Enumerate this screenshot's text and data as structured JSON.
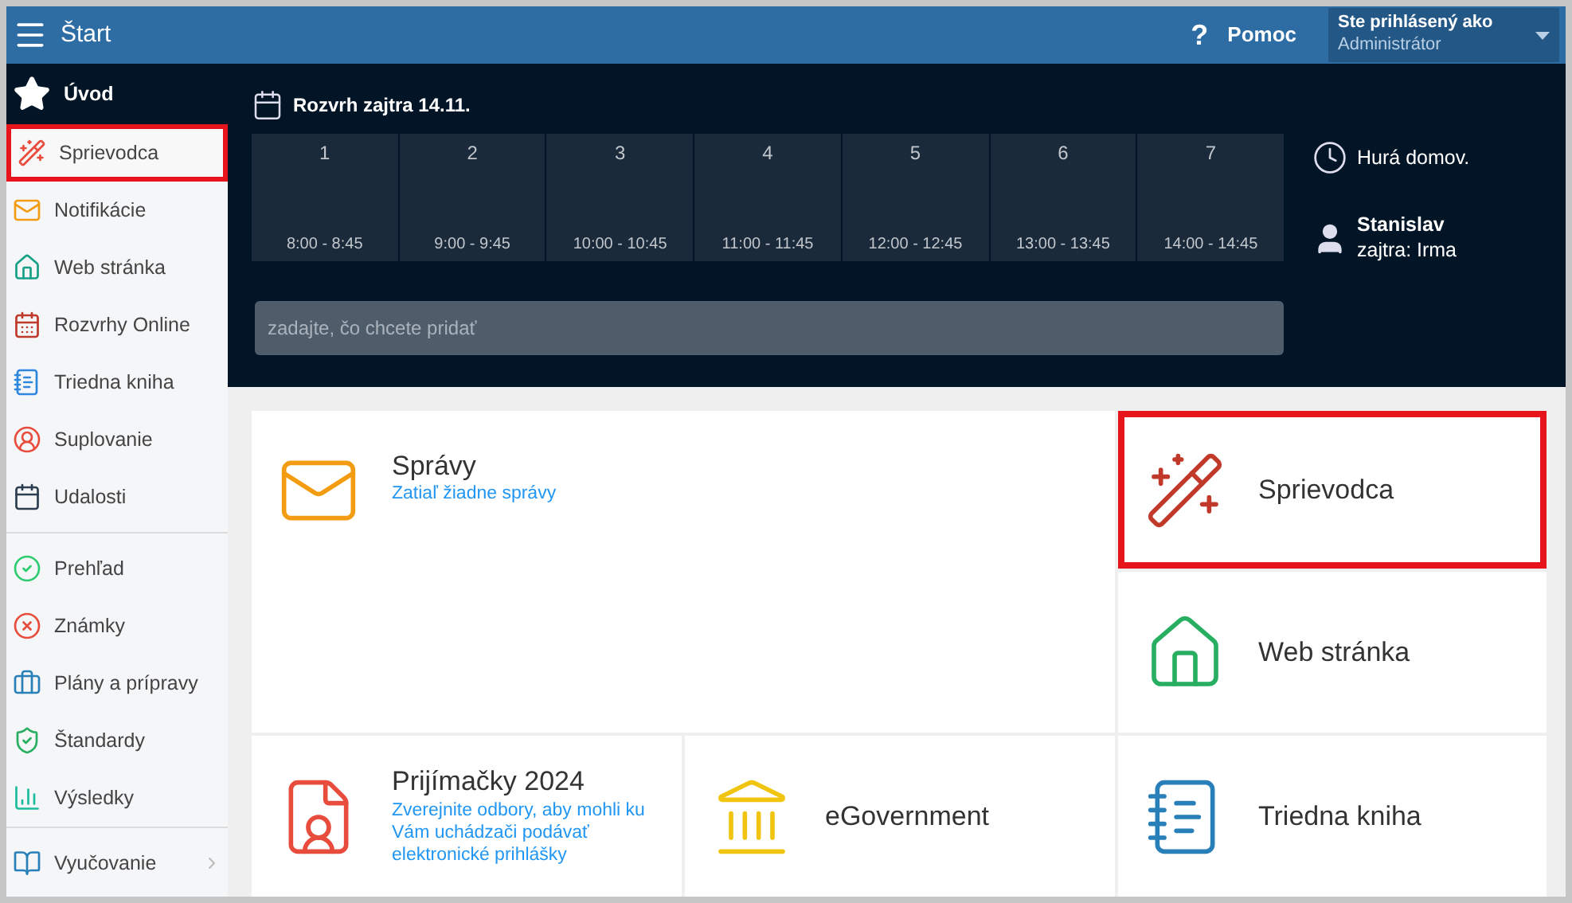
{
  "topbar": {
    "title": "Štart",
    "help_icon": "?",
    "help": "Pomoc",
    "user": {
      "label": "Ste prihlásený ako",
      "value": "Administrátor"
    }
  },
  "sidebar": {
    "sections": [
      [
        {
          "label": "Úvod",
          "selected": true,
          "highlighted": false,
          "submenu": false
        },
        {
          "label": "Sprievodca",
          "selected": false,
          "highlighted": true,
          "submenu": false
        },
        {
          "label": "Notifikácie",
          "selected": false,
          "highlighted": false,
          "submenu": false
        },
        {
          "label": "Web stránka",
          "selected": false,
          "highlighted": false,
          "submenu": false
        },
        {
          "label": "Rozvrhy Online",
          "selected": false,
          "highlighted": false,
          "submenu": false
        },
        {
          "label": "Triedna kniha",
          "selected": false,
          "highlighted": false,
          "submenu": false
        },
        {
          "label": "Suplovanie",
          "selected": false,
          "highlighted": false,
          "submenu": false
        },
        {
          "label": "Udalosti",
          "selected": false,
          "highlighted": false,
          "submenu": false
        }
      ],
      [
        {
          "label": "Prehľad",
          "selected": false,
          "highlighted": false,
          "submenu": false
        },
        {
          "label": "Známky",
          "selected": false,
          "highlighted": false,
          "submenu": false
        },
        {
          "label": "Plány a prípravy",
          "selected": false,
          "highlighted": false,
          "submenu": false
        },
        {
          "label": "Štandardy",
          "selected": false,
          "highlighted": false,
          "submenu": false
        },
        {
          "label": "Výsledky",
          "selected": false,
          "highlighted": false,
          "submenu": false
        }
      ],
      [
        {
          "label": "Vyučovanie",
          "selected": false,
          "highlighted": false,
          "submenu": true
        }
      ]
    ]
  },
  "schedule": {
    "title": "Rozvrh zajtra 14.11.",
    "lessons": [
      {
        "number": "1",
        "time": "8:00 - 8:45"
      },
      {
        "number": "2",
        "time": "9:00 - 9:45"
      },
      {
        "number": "3",
        "time": "10:00 - 10:45"
      },
      {
        "number": "4",
        "time": "11:00 - 11:45"
      },
      {
        "number": "5",
        "time": "12:00 - 12:45"
      },
      {
        "number": "6",
        "time": "13:00 - 13:45"
      },
      {
        "number": "7",
        "time": "14:00 - 14:45"
      }
    ],
    "placeholder": "zadajte, čo chcete pridať"
  },
  "status": {
    "text": "Hurá domov.",
    "person": "Stanislav",
    "note": "zajtra: Irma"
  },
  "tiles": [
    {
      "title": "Správy",
      "subtitle": "Zatiaľ žiadne správy",
      "highlighted": false
    },
    {
      "title": "Sprievodca",
      "highlighted": true
    },
    {
      "title": "Web stránka",
      "highlighted": false
    },
    {
      "title": "Prijímačky 2024",
      "subtitle": "Zverejnite odbory, aby mohli ku Vám uchádzači podávať elektronické prihlášky",
      "highlighted": false
    },
    {
      "title": "eGovernment",
      "highlighted": false
    },
    {
      "title": "Triedna kniha",
      "highlighted": false
    }
  ]
}
